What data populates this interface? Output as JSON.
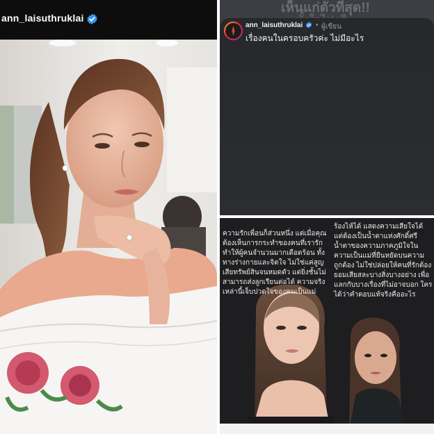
{
  "left_post": {
    "username": "ann_laisuthruklai",
    "verified_icon": "verified-badge-icon",
    "accent": "#3897f0"
  },
  "story_reply": {
    "background_text_line1": "เห็นแก่ตัวที่สุด!!",
    "background_text_line2": "ทั้งใจไป เรื",
    "username": "ann_laisuthruklai",
    "separator": "•",
    "follow_status": "ผู้เขียน",
    "message": "เรื่องคนในครอบครัวค่ะ ไม่มีอะไร"
  },
  "news_graphic": {
    "left_paragraph": "ความรักเพื่อนก็ส่วนหนึ่ง แต่เมื่อคุณต้องเห็นการกระทำของคนที่เรารักทำให้ผู้คนจำนวนมากเดือดร้อน ทั้งทางร่างกายและจิตใจ ไม่ใช่แค่สูญเสียทรัพย์สินจนหมดตัว แต่ยิ่งชั้นไม่สามารถส่งลูกเรียนต่อได้ ความจริงเหล่านี้เจ็บปวดใจของคนเป็นแม่",
    "right_paragraph": "ร้องไห้ได้ แสดงความเสียใจได้ แต่ต้องเป็นน้ำตาแห่งศักดิ์ศรี น้ำตาของความภาคภูมิใจในความเป็นแม่ที่ยืนหยัดบนความถูกต้อง ไม่ใช่ปล่อยให้คนที่รักต้องยอมเสียสละบางสิ่งบางอย่าง เพื่อแลกกับบางเรื่องที่ไม่อาจบอก ใครได้ว่าคำตอบแท้จริงคืออะไร"
  }
}
